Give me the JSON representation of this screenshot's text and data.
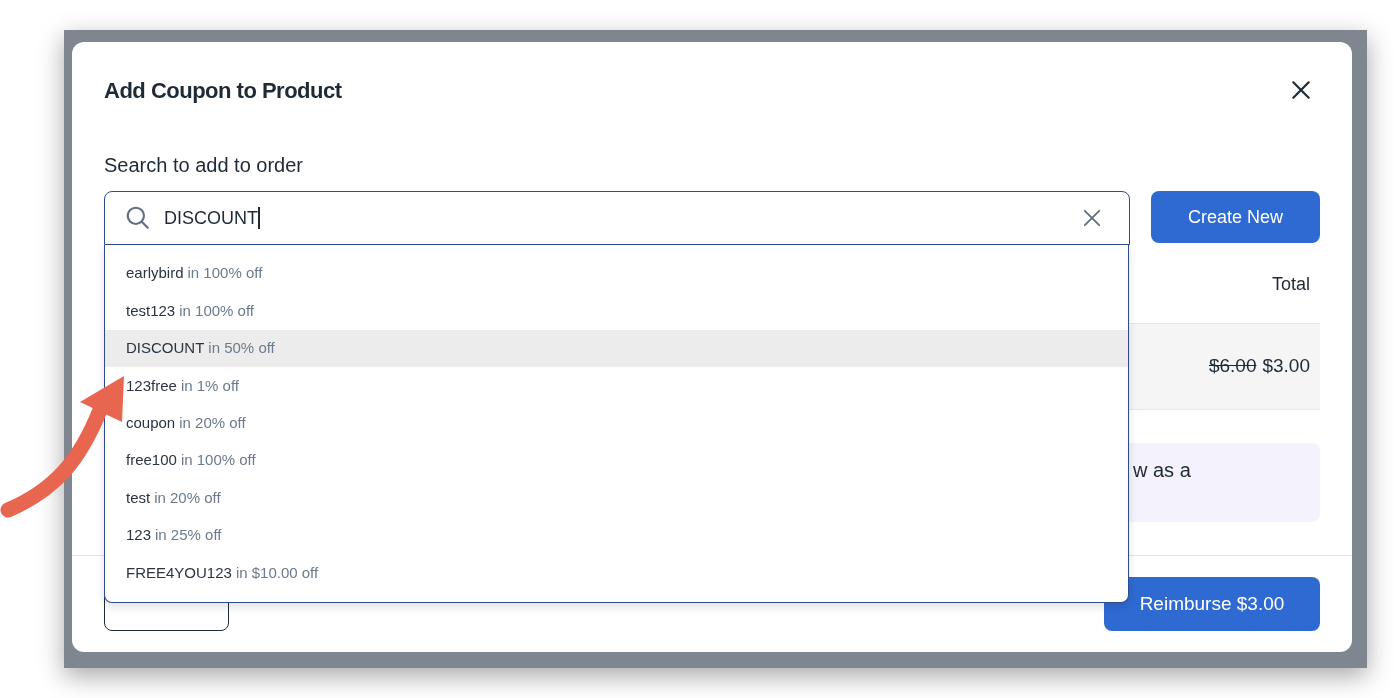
{
  "dialog": {
    "title": "Add Coupon to Product",
    "search_label": "Search to add to order",
    "search": {
      "value": "DISCOUNT"
    },
    "create_button": "Create New",
    "table": {
      "columns": [
        "Total"
      ],
      "row": {
        "original_price": "$6.00",
        "price": "$3.00"
      }
    },
    "note": "w as a",
    "reimburse_button": "Reimburse $3.00"
  },
  "dropdown": {
    "items": [
      {
        "code": "earlybird",
        "detail": "in 100% off",
        "selected": false
      },
      {
        "code": "test123",
        "detail": "in 100% off",
        "selected": false
      },
      {
        "code": "DISCOUNT",
        "detail": "in 50% off",
        "selected": true
      },
      {
        "code": "123free",
        "detail": "in 1% off",
        "selected": false
      },
      {
        "code": "coupon",
        "detail": "in 20% off",
        "selected": false
      },
      {
        "code": "free100",
        "detail": "in 100% off",
        "selected": false
      },
      {
        "code": "test",
        "detail": "in 20% off",
        "selected": false
      },
      {
        "code": "123",
        "detail": "in 25% off",
        "selected": false
      },
      {
        "code": "FREE4YOU123",
        "detail": "in $10.00 off",
        "selected": false
      }
    ]
  }
}
